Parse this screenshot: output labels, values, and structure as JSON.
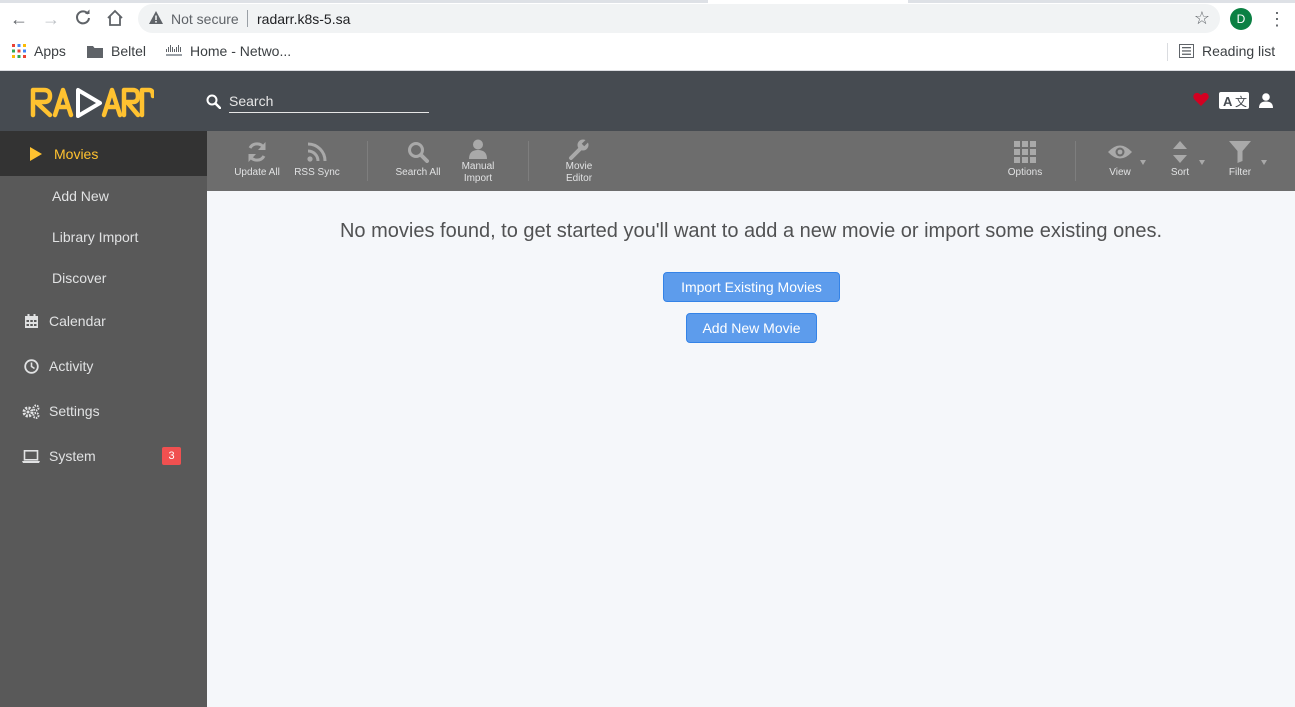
{
  "browser": {
    "security_label": "Not secure",
    "url": "radarr.k8s-5.sa",
    "profile_initial": "D",
    "bookmarks": [
      {
        "label": "Apps"
      },
      {
        "label": "Beltel"
      },
      {
        "label": "Home - Netwo..."
      }
    ],
    "reading_list": "Reading list"
  },
  "header": {
    "logo_text": "RADARR",
    "search_placeholder": "Search",
    "accent_color": "#ffc230",
    "heart_color": "#d30021"
  },
  "sidebar": {
    "items": [
      {
        "label": "Movies",
        "icon": "play-icon",
        "active": true
      },
      {
        "label": "Calendar",
        "icon": "calendar-icon"
      },
      {
        "label": "Activity",
        "icon": "clock-icon"
      },
      {
        "label": "Settings",
        "icon": "cogs-icon"
      },
      {
        "label": "System",
        "icon": "laptop-icon",
        "badge": "3"
      }
    ],
    "movies_children": [
      {
        "label": "Add New"
      },
      {
        "label": "Library Import"
      },
      {
        "label": "Discover"
      }
    ]
  },
  "toolbar": {
    "update_all": "Update All",
    "rss_sync": "RSS Sync",
    "search_all": "Search All",
    "manual_import_1": "Manual",
    "manual_import_2": "Import",
    "movie_editor_1": "Movie",
    "movie_editor_2": "Editor",
    "options": "Options",
    "view": "View",
    "sort": "Sort",
    "filter": "Filter"
  },
  "main": {
    "empty_message": "No movies found, to get started you'll want to add a new movie or import some existing ones.",
    "import_button": "Import Existing Movies",
    "add_button": "Add New Movie"
  }
}
